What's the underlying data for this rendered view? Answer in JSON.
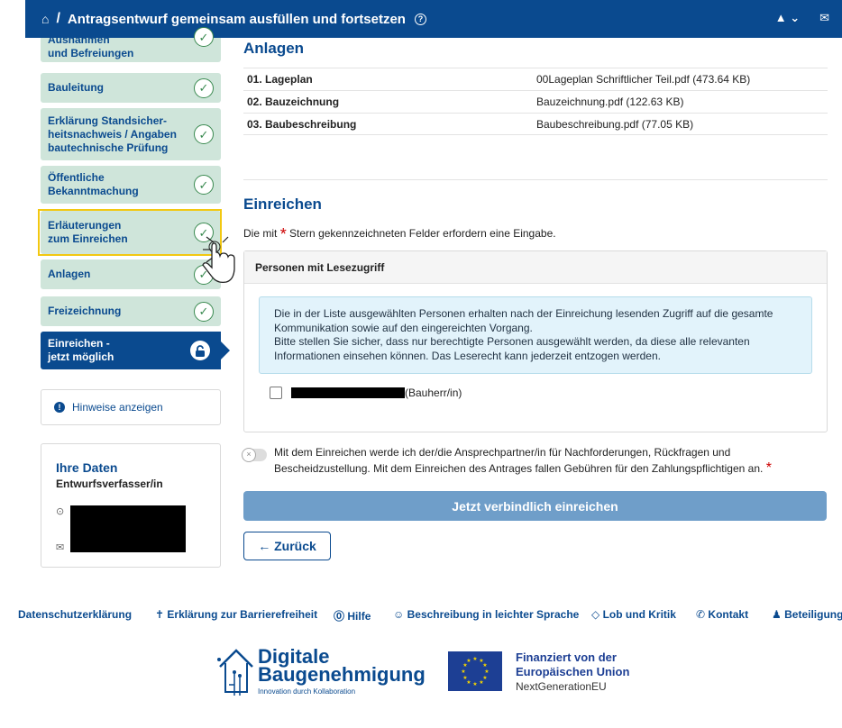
{
  "header": {
    "title": "Antragsentwurf gemeinsam ausfüllen und fortsetzen",
    "separator": "/",
    "help_glyph": "?",
    "user_glyph": "▲ ⌄",
    "mail_glyph": "✉",
    "home_glyph": "⌂"
  },
  "sidebar": {
    "steps": [
      {
        "line1": "Ausnahmen",
        "line2": "und Befreiungen"
      },
      {
        "line1": "Bauleitung",
        "line2": ""
      },
      {
        "line1": "Erklärung Standsicher-",
        "line2": "heitsnachweis / Angaben",
        "line3": "bautechnische Prüfung"
      },
      {
        "line1": "Öffentliche",
        "line2": "Bekanntmachung"
      },
      {
        "line1": "Erläuterungen",
        "line2": "zum Einreichen"
      },
      {
        "line1": "Anlagen",
        "line2": ""
      },
      {
        "line1": "Freizeichnung",
        "line2": ""
      },
      {
        "line1": "Einreichen -",
        "line2": "jetzt möglich"
      }
    ],
    "check_glyph": "✓",
    "lock_glyph": "🔓"
  },
  "hints": {
    "label": "Hinweise anzeigen",
    "glyph": "!"
  },
  "your_data": {
    "title": "Ihre Daten",
    "role": "Entwurfsverfasser/in",
    "pin_glyph": "⊙",
    "mail_glyph": "✉"
  },
  "anlagen": {
    "title": "Anlagen",
    "rows": [
      {
        "name": "01. Lageplan",
        "file": "00Lageplan Schriftlicher Teil.pdf (473.64 KB)"
      },
      {
        "name": "02. Bauzeichnung",
        "file": "Bauzeichnung.pdf (122.63 KB)"
      },
      {
        "name": "03. Baubeschreibung",
        "file": "Baubeschreibung.pdf (77.05 KB)"
      }
    ]
  },
  "einreichen": {
    "title": "Einreichen",
    "required_prefix": "Die mit",
    "required_star": "*",
    "required_suffix": "Stern gekennzeichneten Felder erfordern eine Eingabe.",
    "panel_title": "Personen mit Lesezugriff",
    "info_lines": [
      "Die in der Liste ausgewählten Personen erhalten nach der Einreichung lesenden Zugriff auf die gesamte",
      "Kommunikation sowie auf den eingereichten Vorgang.",
      "Bitte stellen Sie sicher, dass nur berechtigte Personen ausgewählt werden, da diese alle relevanten",
      "Informationen einsehen können. Das Leserecht kann jederzeit entzogen werden."
    ],
    "person_role": "(Bauherr/in)",
    "toggle_text_1": "Mit dem Einreichen werde ich der/die Ansprechpartner/in für Nachforderungen, Rückfragen und",
    "toggle_text_2": "Bescheidzustellung. Mit dem Einreichen des Antrages fallen Gebühren für den Zahlungspflichtigen an.",
    "submit_label": "Jetzt verbindlich einreichen",
    "back_label": "← Zurück"
  },
  "footer": {
    "links": [
      {
        "icon": "",
        "label": "Datenschutzerklärung"
      },
      {
        "icon": "✝",
        "label": "Erklärung zur Barrierefreiheit"
      },
      {
        "icon": "⓪",
        "label": "Hilfe"
      },
      {
        "icon": "☺",
        "label": "Beschreibung in leichter Sprache"
      },
      {
        "icon": "◇",
        "label": "Lob und Kritik"
      },
      {
        "icon": "✆",
        "label": "Kontakt"
      },
      {
        "icon": "♟",
        "label": "Beteiligung"
      }
    ]
  },
  "logos": {
    "dbg_line1": "Digitale",
    "dbg_line2": "Baugenehmigung",
    "dbg_line3": "Innovation durch Kollaboration",
    "eu_line1": "Finanziert von der",
    "eu_line2": "Europäischen Union",
    "eu_line3": "NextGenerationEU"
  }
}
